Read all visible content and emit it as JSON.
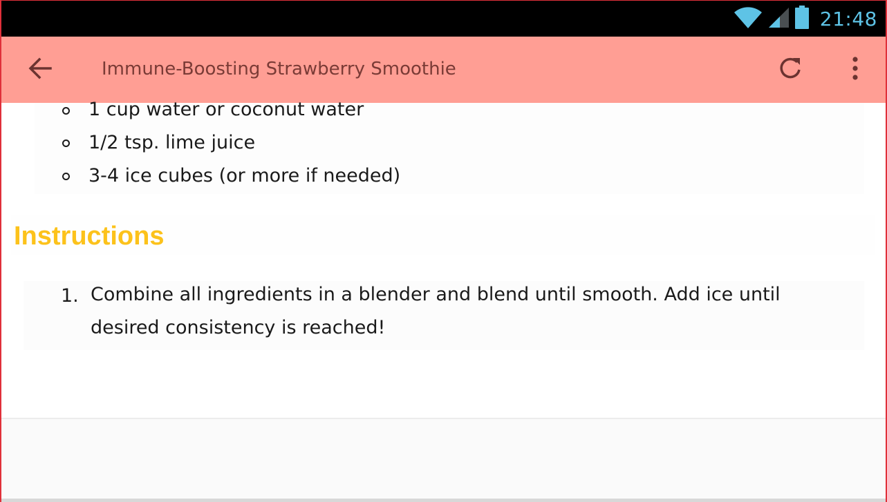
{
  "status_bar": {
    "time": "21:48",
    "icons": [
      "wifi-icon",
      "signal-icon",
      "battery-icon"
    ],
    "time_color": "#5ec3e6"
  },
  "app_bar": {
    "title": "Immune-Boosting Strawberry Smoothie",
    "background": "#ff9e94",
    "icons": [
      "arrow-back-icon",
      "refresh-icon",
      "more-vert-icon"
    ]
  },
  "ingredients": {
    "items": [
      "1 cup water or coconut water",
      "1/2 tsp. lime juice",
      "3-4 ice cubes (or more if needed)"
    ]
  },
  "instructions": {
    "heading": "Instructions",
    "heading_color": "#fcc21b",
    "steps": [
      {
        "number": "1.",
        "text": "Combine all ingredients in a blender and blend until smooth. Add ice until desired consistency is reached!"
      }
    ]
  }
}
